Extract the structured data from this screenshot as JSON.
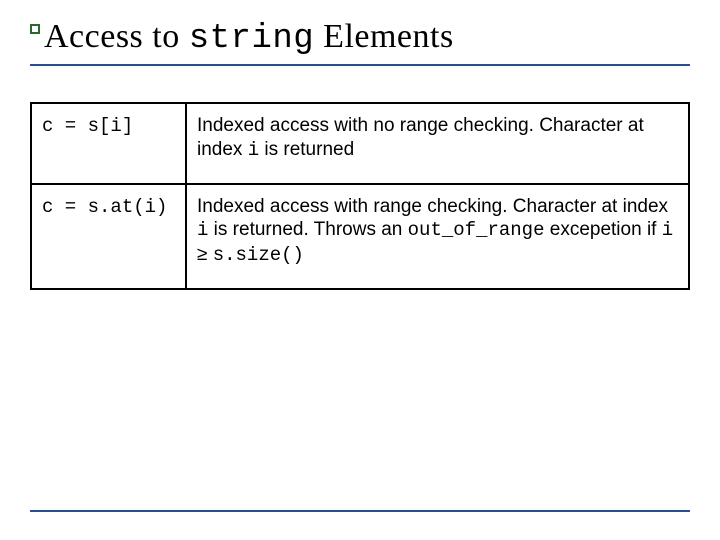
{
  "title": {
    "pre": "Access to ",
    "code": "string",
    "post": " Elements"
  },
  "rows": [
    {
      "code": "c = s[i]",
      "desc": {
        "p1a": "Indexed access with no range checking. Character at index ",
        "c1": "i",
        "p1b": " is returned"
      }
    },
    {
      "code": "c = s.at(i)",
      "desc": {
        "p1a": "Indexed access with range checking.  Character at index ",
        "c1": "i",
        "p1b": " is returned.  Throws an ",
        "c2": "out_of_range",
        "p2a": " excepetion if ",
        "c3": "i",
        "p2b": " ≥ ",
        "c4": "s.size()"
      }
    }
  ]
}
